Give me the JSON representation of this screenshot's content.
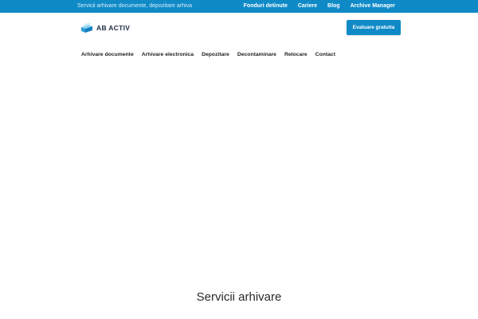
{
  "topbar": {
    "tagline": "Servicii arhivare documente, depozitare arhiva",
    "links": [
      "Fonduri detinute",
      "Cariere",
      "Blog",
      "Archive Manager"
    ]
  },
  "header": {
    "logo_text": "AB ACTIV",
    "cta_label": "Evaluare gratuita"
  },
  "nav": {
    "items": [
      "Arhivare documente",
      "Arhivare electronica",
      "Depozitare",
      "Decontaminare",
      "Relocare",
      "Contact"
    ]
  },
  "section": {
    "title": "Servicii arhivare"
  },
  "colors": {
    "brand": "#0f8ac7",
    "text_dark": "#1f1f1f",
    "logo_dark": "#1d2a44"
  },
  "icons": {
    "logo": "stacked-boxes-logo-icon"
  }
}
